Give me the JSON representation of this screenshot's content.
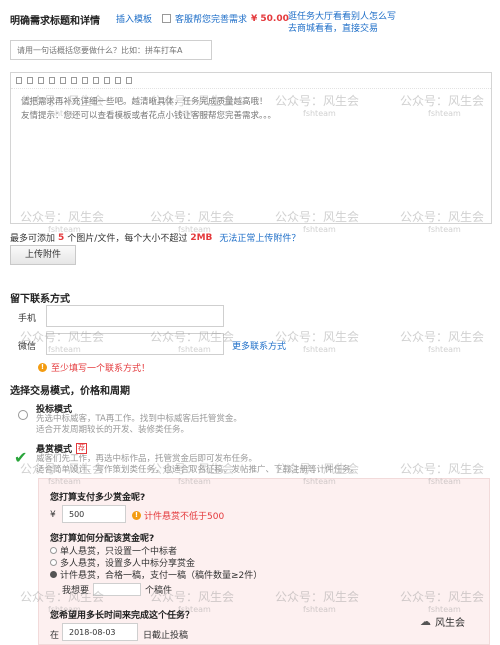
{
  "section_detail": {
    "title": "明确需求标题和详情",
    "template_link": "插入模板",
    "service_checkbox_label": "客服帮您完善需求",
    "service_price": "¥ 50.00",
    "hall_link_line1": "逛任务大厅看看别人怎么写",
    "hall_link_line2": "去商城看看，直接交易",
    "title_placeholder": "请用一句话概括您要做什么？比如：拼车打车A",
    "editor_line1": "请把需求再补充详细一些吧。越清晰具体，任务完成质量越高哦！",
    "editor_line2": "友情提示：您还可以查看模板或者花点小钱让客服帮您完善需求。。。",
    "attach_prefix": "最多可添加",
    "attach_count": "5",
    "attach_mid": "个图片/文件，每个大小不超过",
    "attach_size": "2MB",
    "attach_help_link": "无法正常上传附件？",
    "upload_button": "上传附件"
  },
  "section_contact": {
    "title": "留下联系方式",
    "phone_label": "手机",
    "wechat_label": "微信",
    "more_contact_link": "更多联系方式",
    "warning": "至少填写一个联系方式！"
  },
  "section_mode": {
    "title": "选择交易模式，价格和周期",
    "bid_title": "投标模式",
    "bid_desc1": "先选中标威客，TA再工作。找到中标威客后托管赏金。",
    "bid_desc2": "适合开发周期较长的开发、装修类任务。",
    "reward_title": "悬赏模式",
    "reward_badge": "荐",
    "reward_desc1": "威客们先工作，再选中标作品，托管赏金后即可发布任务。",
    "reward_desc2": "适合简单设计、写作策划类任务，也适合取名征稿、发帖推广、下载注册等计件任务。"
  },
  "reward_box": {
    "budget_question": "您打算支付多少赏金呢?",
    "currency": "¥",
    "budget_value": "500",
    "budget_warning": "计件悬赏不低于500",
    "distribution_question": "您打算如何分配该赏金呢?",
    "options": [
      "单人悬赏，只设置一个中标者",
      "多人悬赏，设置多人中标分享赏金",
      "计件悬赏，合格一稿，支付一稿（稿件数量≥2件）"
    ],
    "custom_label": "我想要",
    "custom_unit": "个稿件",
    "deadline_question": "您希望用多长时间来完成这个任务？",
    "deadline_prefix": "在",
    "deadline_value": "2018-08-03",
    "deadline_suffix": "日截止投稿"
  },
  "watermark": {
    "text": "公众号：风生会",
    "sub": "fshteam",
    "brand": "风生会"
  },
  "colors": {
    "link": "#1f6fc8",
    "red": "#e4393c",
    "warning": "#f39c12",
    "check": "#2aa53b",
    "pink_bg": "#fdf0f0"
  }
}
